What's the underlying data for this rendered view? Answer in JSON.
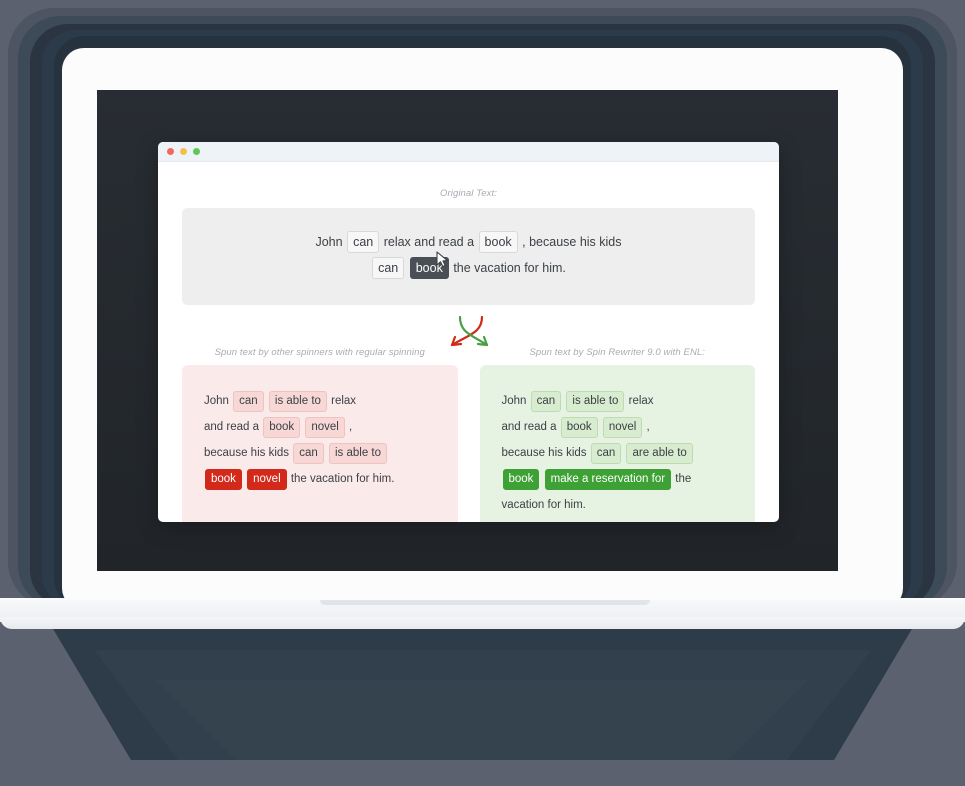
{
  "window": {
    "traffic_lights": [
      "close-red",
      "minimize-yellow",
      "maximize-green"
    ]
  },
  "original": {
    "caption": "Original Text:",
    "line1": [
      {
        "type": "text",
        "value": "John"
      },
      {
        "type": "chip",
        "style": "plain",
        "value": "can"
      },
      {
        "type": "text",
        "value": "relax and read a"
      },
      {
        "type": "chip",
        "style": "plain",
        "value": "book"
      },
      {
        "type": "text",
        "value": ", because his kids"
      }
    ],
    "line2": [
      {
        "type": "chip",
        "style": "plain",
        "value": "can"
      },
      {
        "type": "chip",
        "style": "dark",
        "value": "book"
      },
      {
        "type": "text",
        "value": "the vacation for him."
      }
    ]
  },
  "arrows": {
    "left_arrow_color": "#cf2a18",
    "right_arrow_color": "#49a043",
    "left_arrow_name": "red-curved-arrow-down-left",
    "right_arrow_name": "green-curved-arrow-down-right"
  },
  "panels": [
    {
      "id": "other-spinners",
      "caption": "Spun text by other spinners with regular spinning",
      "verdict": "bad",
      "badge_glyph": "✕",
      "badge_label": "incorrect-result",
      "badge_color": "#cf2a18",
      "background": "#fbeaea",
      "lines": [
        [
          {
            "type": "text",
            "value": "John"
          },
          {
            "type": "chip",
            "style": "soft",
            "value": "can"
          },
          {
            "type": "chip",
            "style": "soft",
            "value": "is able to"
          },
          {
            "type": "text",
            "value": "relax"
          }
        ],
        [
          {
            "type": "text",
            "value": "and read a"
          },
          {
            "type": "chip",
            "style": "soft",
            "value": "book"
          },
          {
            "type": "chip",
            "style": "soft",
            "value": "novel"
          },
          {
            "type": "text",
            "value": ","
          }
        ],
        [
          {
            "type": "text",
            "value": "because his kids"
          },
          {
            "type": "chip",
            "style": "soft",
            "value": "can"
          },
          {
            "type": "chip",
            "style": "soft",
            "value": "is able to"
          }
        ],
        [
          {
            "type": "chip",
            "style": "strong",
            "value": "book"
          },
          {
            "type": "chip",
            "style": "strong",
            "value": "novel"
          },
          {
            "type": "text",
            "value": "the vacation for him."
          }
        ]
      ]
    },
    {
      "id": "spin-rewriter",
      "caption": "Spun text by Spin Rewriter 9.0 with ENL:",
      "verdict": "good",
      "badge_glyph": "✓",
      "badge_label": "correct-result",
      "badge_color": "#49a043",
      "background": "#e7f3e2",
      "lines": [
        [
          {
            "type": "text",
            "value": "John"
          },
          {
            "type": "chip",
            "style": "soft",
            "value": "can"
          },
          {
            "type": "chip",
            "style": "soft",
            "value": "is able to"
          },
          {
            "type": "text",
            "value": "relax"
          }
        ],
        [
          {
            "type": "text",
            "value": "and read a"
          },
          {
            "type": "chip",
            "style": "soft",
            "value": "book"
          },
          {
            "type": "chip",
            "style": "soft",
            "value": "novel"
          },
          {
            "type": "text",
            "value": ","
          }
        ],
        [
          {
            "type": "text",
            "value": "because his kids"
          },
          {
            "type": "chip",
            "style": "soft",
            "value": "can"
          },
          {
            "type": "chip",
            "style": "soft",
            "value": "are able to"
          }
        ],
        [
          {
            "type": "chip",
            "style": "strong",
            "value": "book"
          },
          {
            "type": "chip",
            "style": "strong",
            "value": "make a reservation for"
          },
          {
            "type": "text",
            "value": "the"
          }
        ],
        [
          {
            "type": "text",
            "value": "vacation for him."
          }
        ]
      ]
    }
  ],
  "colors": {
    "scene_background": "#5b616e",
    "screen": "#252a2f",
    "bezel": "#fcfcfd",
    "original_box": "#eeeeee",
    "caption_text": "#a6acb3"
  }
}
